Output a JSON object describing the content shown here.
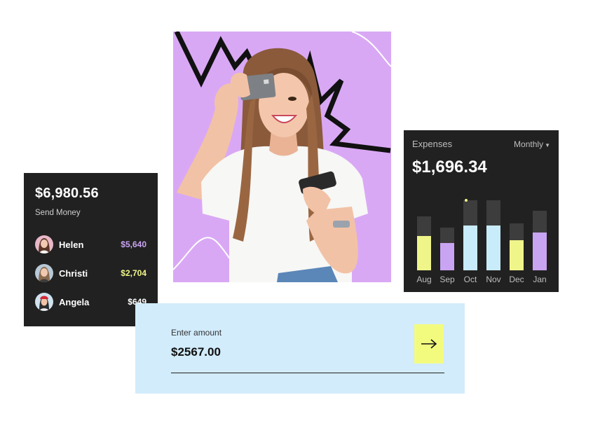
{
  "send_money": {
    "balance": "$6,980.56",
    "subtitle": "Send Money",
    "contacts": [
      {
        "name": "Helen",
        "amount": "$5,640",
        "amount_color": "#c9a4f2"
      },
      {
        "name": "Christi",
        "amount": "$2,704",
        "amount_color": "#f0f58a"
      },
      {
        "name": "Angela",
        "amount": "$649",
        "amount_color": "#ffffff"
      }
    ]
  },
  "expenses": {
    "title": "Expenses",
    "period": "Monthly",
    "total": "$1,696.34"
  },
  "amount_entry": {
    "label": "Enter amount",
    "value": "$2567.00"
  },
  "colors": {
    "lavender": "#d9a8f5",
    "yellow": "#f3fb7f",
    "light_blue": "#d2ecfb",
    "dark_card": "#212121"
  },
  "chart_data": {
    "type": "bar",
    "categories": [
      "Aug",
      "Sep",
      "Oct",
      "Nov",
      "Dec",
      "Jan"
    ],
    "series": [
      {
        "values": [
          77,
          61,
          100,
          100,
          67,
          85
        ]
      },
      {
        "values": [
          49,
          39,
          64,
          64,
          43,
          54
        ]
      }
    ],
    "bar_colors": [
      "#f0f58a",
      "#c9a4f2",
      "#c9ecfb",
      "#c9ecfb",
      "#f0f58a",
      "#c9a4f2"
    ],
    "highlight": "Oct",
    "ylim": [
      0,
      100
    ]
  }
}
